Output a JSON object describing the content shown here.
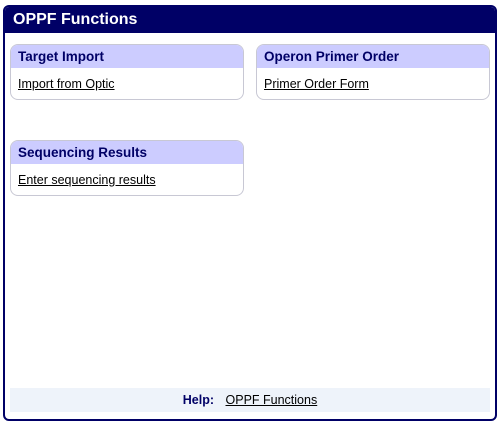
{
  "panel": {
    "title": "OPPF Functions"
  },
  "boxes": {
    "target_import": {
      "title": "Target Import",
      "link": "Import from Optic"
    },
    "operon_primer_order": {
      "title": "Operon Primer Order",
      "link": "Primer Order Form"
    },
    "sequencing_results": {
      "title": "Sequencing Results",
      "link": "Enter sequencing results"
    }
  },
  "help": {
    "label": "Help:",
    "link": "OPPF Functions"
  },
  "colors": {
    "header_bg": "#000066",
    "box_title_bg": "#ccccff",
    "help_bg": "#eef3fa"
  }
}
